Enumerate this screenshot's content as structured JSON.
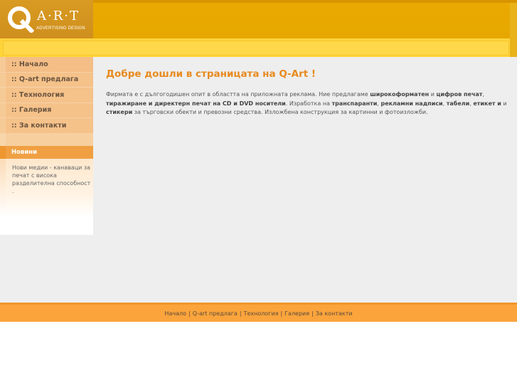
{
  "brand": {
    "logo_letter": "Q",
    "logo_rest": "A·R·T",
    "tagline": "ADVERTISING DESIGN"
  },
  "menu": {
    "items": [
      {
        "label": ":: Начало"
      },
      {
        "label": ":: Q-art предлага"
      },
      {
        "label": ":: Технология"
      },
      {
        "label": ":: Галерия"
      },
      {
        "label": ":: За контакти"
      }
    ]
  },
  "news": {
    "title": "Новини",
    "text": "Нови медии - канаваци за печат с висока разделителна способност ."
  },
  "main": {
    "title": "Добре дошли в страницата на Q-Art !",
    "intro": {
      "t1": "Фирмата е с дългогодишен опит в областта на приложната реклама. Ние предлагаме ",
      "b1": "широкоформатен",
      "t2": " и ",
      "b2": "цифров печат",
      "t3": ", ",
      "b3": "тиражиране и директерн печат на CD и DVD носители",
      "t4": ". Изработка на ",
      "b4": "транспаранти",
      "t5": ", ",
      "b5": "рекламни надписи",
      "t6": ", ",
      "b6": "табели",
      "t7": ", ",
      "b7": "етикет и",
      "t8": " и ",
      "b8": "стикери",
      "t9": " за търговски обекти и превозни средства. Изложбена конструкция за картинни и фотоизложби."
    }
  },
  "footer": {
    "links": [
      "Начало",
      "Q-art предлага",
      "Технология",
      "Галерия",
      "За контакти"
    ],
    "separator": "|"
  },
  "colors": {
    "header": "#e6a800",
    "accent": "#e88a1f",
    "menu": "#f5c28a",
    "footer": "#fba43c"
  }
}
